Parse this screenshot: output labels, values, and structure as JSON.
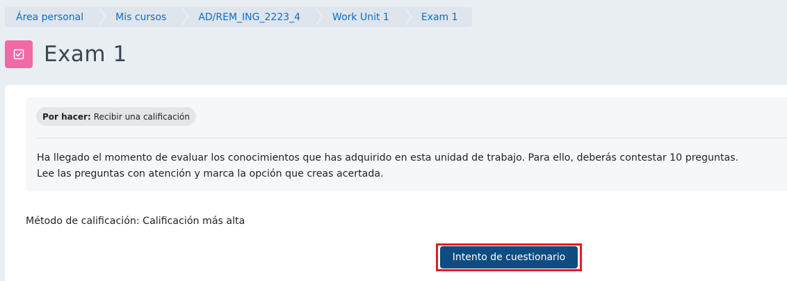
{
  "breadcrumb": {
    "items": [
      {
        "label": "Área personal"
      },
      {
        "label": "Mis cursos"
      },
      {
        "label": "AD/REM_ING_2223_4"
      },
      {
        "label": "Work Unit 1"
      },
      {
        "label": "Exam 1"
      }
    ]
  },
  "header": {
    "icon": "quiz-checkbox-icon",
    "title": "Exam 1",
    "icon_color": "#f06aa6"
  },
  "activity": {
    "todo_label": "Por hacer:",
    "todo_text": "Recibir una calificación",
    "description": [
      "Ha llegado el momento de evaluar los conocimientos que has adquirido en esta unidad de trabajo. Para ello, deberás contestar 10 preguntas.",
      "Lee las preguntas con atención y marca la opción que creas acertada."
    ],
    "grading_method": "Método de calificación: Calificación más alta",
    "attempt_button": "Intento de cuestionario"
  },
  "colors": {
    "link": "#0f6cbf",
    "button": "#0f4c81",
    "highlight": "#e31b23"
  }
}
